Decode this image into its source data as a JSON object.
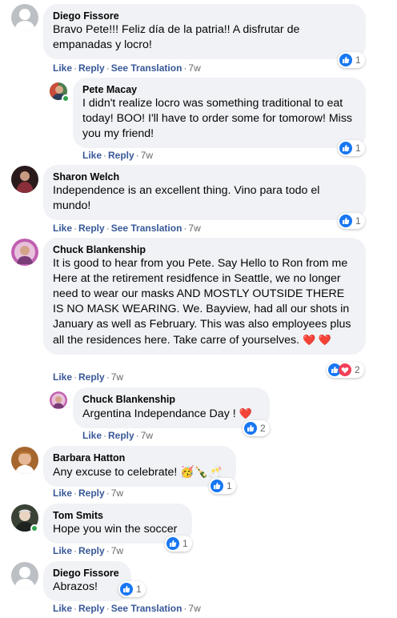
{
  "colors": {
    "bubble_bg": "#f0f2f5",
    "link_blue": "#385898",
    "meta_gray": "#65676b",
    "like_blue": "#1877f2",
    "love_red": "#f33e58",
    "online_green": "#31a24c"
  },
  "actions": {
    "like": "Like",
    "reply": "Reply",
    "see_translation": "See Translation",
    "separator": "·"
  },
  "comments": [
    {
      "author": "Diego Fissore",
      "text": "Bravo Pete!!! Feliz día de la patria!! A disfrutar de empanadas y locro!",
      "time": "7w",
      "reactions": {
        "count": "1",
        "icons": [
          "like-icon"
        ]
      }
    },
    {
      "author": "Pete Macay",
      "text": "I didn't realize locro was something traditional to eat today! BOO! I'll have to order some for tomorow! Miss you my friend!",
      "time": "7w",
      "reactions": {
        "count": "1",
        "icons": [
          "like-icon"
        ]
      }
    },
    {
      "author": "Sharon Welch",
      "text": "Independence is an excellent thing. Vino para todo el mundo!",
      "time": "7w",
      "reactions": {
        "count": "1",
        "icons": [
          "like-icon"
        ]
      }
    },
    {
      "author": "Chuck Blankenship",
      "text": "It is good to hear from you Pete. Say Hello to Ron from me Here at the retirement residfence in Seattle, we no longer need to wear our masks AND MOSTLY OUTSIDE THERE IS NO MASK WEARING. We. Bayview, had all our shots in January as well as February. This was also employees plus all the residences here. Take carre of yourselves.",
      "emoji_suffix": "❤️ ❤️",
      "time": "7w",
      "reactions": {
        "count": "2",
        "icons": [
          "like-icon",
          "love-icon"
        ]
      }
    },
    {
      "author": "Chuck Blankenship",
      "text": "Argentina Independance Day !",
      "emoji_suffix": "❤️",
      "time": "7w",
      "reactions": {
        "count": "2",
        "icons": [
          "like-icon"
        ]
      }
    },
    {
      "author": "Barbara Hatton",
      "text": "Any excuse to celebrate!",
      "emoji_suffix": "🥳🍾🥂",
      "time": "7w",
      "reactions": {
        "count": "1",
        "icons": [
          "like-icon"
        ]
      }
    },
    {
      "author": "Tom Smits",
      "text": "Hope you win the soccer",
      "time": "7w",
      "reactions": {
        "count": "1",
        "icons": [
          "like-icon"
        ]
      }
    },
    {
      "author": "Diego Fissore",
      "text": "Abrazos!",
      "time": "7w",
      "reactions": {
        "count": "1",
        "icons": [
          "like-icon"
        ]
      }
    }
  ]
}
